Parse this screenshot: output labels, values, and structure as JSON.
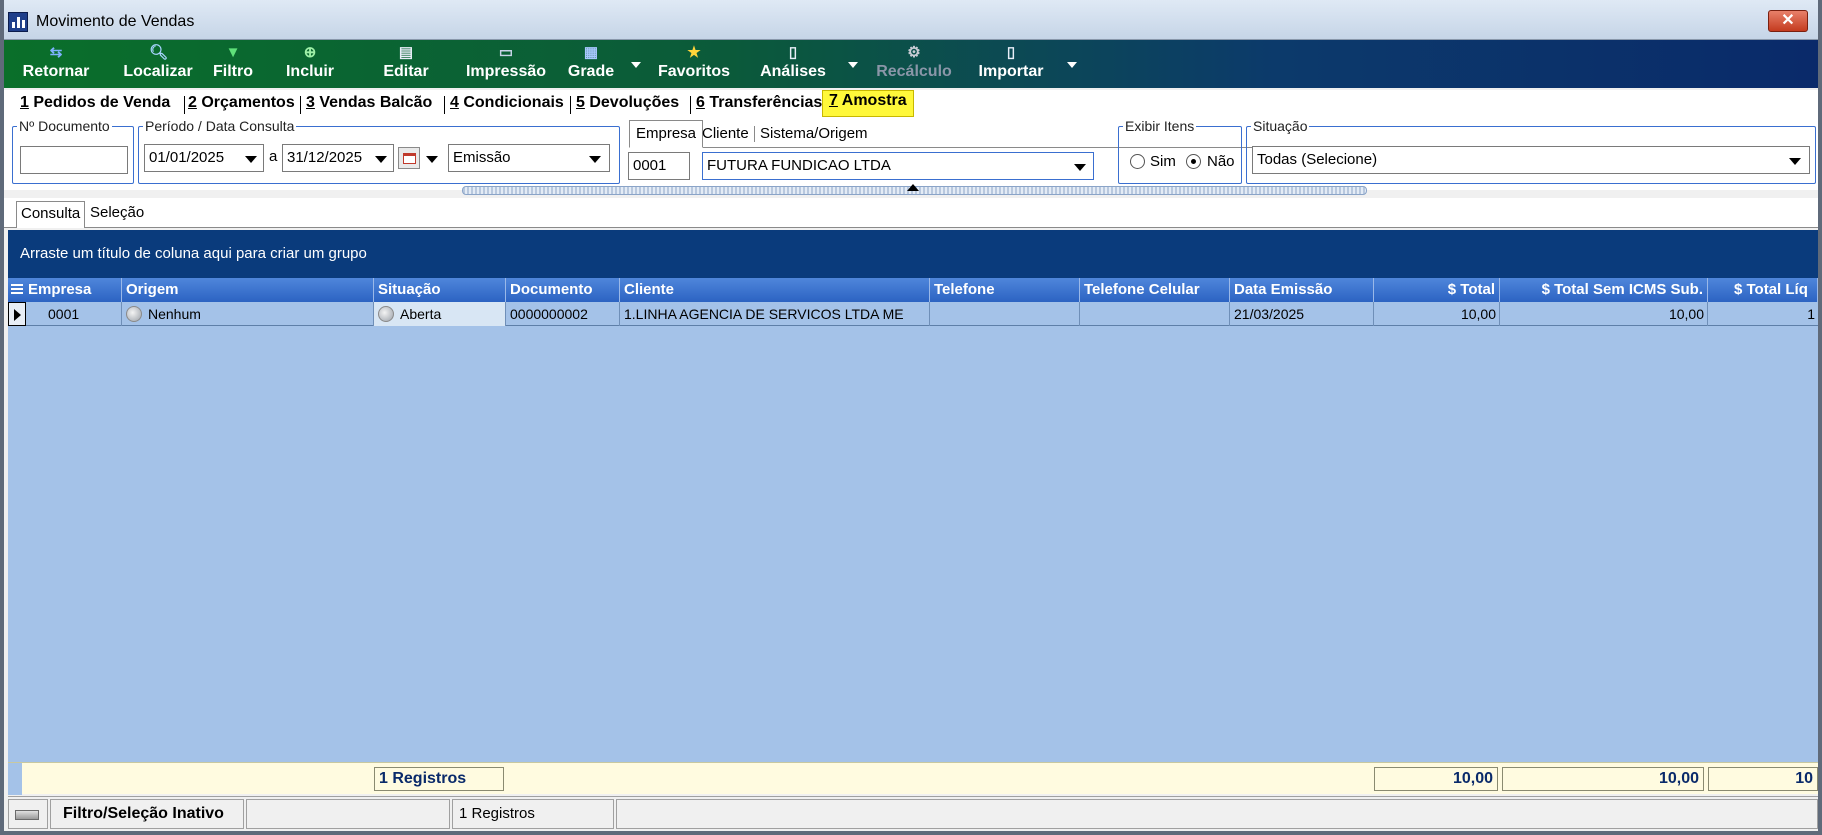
{
  "window": {
    "title": "Movimento de Vendas",
    "close": "✕"
  },
  "toolbar": {
    "retornar": "Retornar",
    "localizar": "Localizar",
    "filtro": "Filtro",
    "incluir": "Incluir",
    "editar": "Editar",
    "impressao": "Impressão",
    "grade": "Grade",
    "favoritos": "Favoritos",
    "analises": "Análises",
    "recalculo": "Recálculo",
    "importar": "Importar"
  },
  "tabs": [
    {
      "num": "1",
      "label": " Pedidos de Venda"
    },
    {
      "num": "2",
      "label": " Orçamentos"
    },
    {
      "num": "3",
      "label": " Vendas Balcão"
    },
    {
      "num": "4",
      "label": " Condicionais"
    },
    {
      "num": "5",
      "label": " Devoluções"
    },
    {
      "num": "6",
      "label": " Transferências"
    },
    {
      "num": "7",
      "label": " Amostra"
    }
  ],
  "filters": {
    "documento": {
      "legend": "Nº Documento",
      "value": ""
    },
    "periodo": {
      "legend": "Período / Data Consulta",
      "from": "01/01/2025",
      "sep": "a",
      "to": "31/12/2025",
      "tipo": "Emissão"
    },
    "empresa_tabs": {
      "empresa": "Empresa",
      "cliente": "Cliente",
      "sistema": "Sistema/Origem"
    },
    "empresa": {
      "code": "0001",
      "name": "FUTURA FUNDICAO LTDA"
    },
    "exibir": {
      "legend": "Exibir Itens",
      "sim": "Sim",
      "nao": "Não",
      "selected": "Não"
    },
    "situacao": {
      "legend": "Situação",
      "value": "Todas (Selecione)"
    }
  },
  "view_tabs": {
    "consulta": "Consulta",
    "selecao": "Seleção"
  },
  "group_bar": "Arraste um título de coluna aqui para criar um grupo",
  "columns": [
    "Empresa",
    "Origem",
    "Situação",
    "Documento",
    "Cliente",
    "Telefone",
    "Telefone Celular",
    "Data Emissão",
    "$ Total",
    "$ Total Sem ICMS Sub.",
    "$ Total Líq"
  ],
  "rows": [
    {
      "empresa": "0001",
      "origem": "Nenhum",
      "situacao": "Aberta",
      "documento": "0000000002",
      "cliente": "1.LINHA AGENCIA DE SERVICOS LTDA ME",
      "telefone": "",
      "celular": "",
      "data": "21/03/2025",
      "total": "10,00",
      "total_sem_icms": "10,00",
      "total_liq": "1"
    }
  ],
  "footer": {
    "registros": "1 Registros",
    "total": "10,00",
    "total_sem_icms": "10,00",
    "total_liq": "10"
  },
  "statusbar": {
    "filtro": "Filtro/Seleção Inativo",
    "registros": "1 Registros"
  },
  "colors": {
    "toolbar_green": "#0a6f2a",
    "toolbar_blue": "#0a2a6a",
    "grid_bg": "#a4c2e8",
    "header_blue": "#2c63c2",
    "active_tab": "#fff83a"
  }
}
